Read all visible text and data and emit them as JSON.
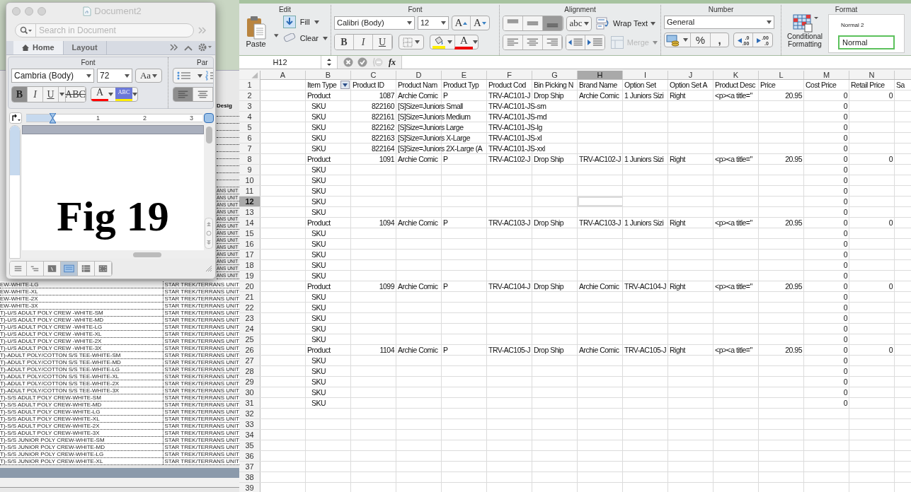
{
  "background_sheet": {
    "header": "Desig",
    "strip_rows": [
      "ANS UNIT",
      "ANS UNIT",
      "ANS UNIT",
      "ANS UNIT",
      "ANS UNIT",
      "ANS UNIT",
      "ANS UNIT",
      "ANS UNIT",
      "ANS UNIT",
      "ANS UNIT",
      "ANS UNIT",
      "ANS UNIT",
      "ANS UNIT"
    ],
    "rows": [
      {
        "description": "EW-WHITE-LG",
        "design": "STAR TREK/TERRANS UNIT"
      },
      {
        "description": "EW-WHITE-XL",
        "design": "STAR TREK/TERRANS UNIT"
      },
      {
        "description": "EW-WHITE-2X",
        "design": "STAR TREK/TERRANS UNIT"
      },
      {
        "description": "EW-WHITE-3X",
        "design": "STAR TREK/TERRANS UNIT"
      },
      {
        "description": "T)-U/S ADULT POLY CREW -WHITE-SM",
        "design": "STAR TREK/TERRANS UNIT"
      },
      {
        "description": "T)-U/S ADULT POLY CREW -WHITE-MD",
        "design": "STAR TREK/TERRANS UNIT"
      },
      {
        "description": "T)-U/S ADULT POLY CREW -WHITE-LG",
        "design": "STAR TREK/TERRANS UNIT"
      },
      {
        "description": "T)-U/S ADULT POLY CREW -WHITE-XL",
        "design": "STAR TREK/TERRANS UNIT"
      },
      {
        "description": "T)-U/S ADULT POLY CREW -WHITE-2X",
        "design": "STAR TREK/TERRANS UNIT"
      },
      {
        "description": "T)-U/S ADULT POLY CREW -WHITE-3X",
        "design": "STAR TREK/TERRANS UNIT"
      },
      {
        "description": "T)-ADULT POLY/COTTON S/S TEE-WHITE-SM",
        "design": "STAR TREK/TERRANS UNIT"
      },
      {
        "description": "T)-ADULT POLY/COTTON S/S TEE-WHITE-MD",
        "design": "STAR TREK/TERRANS UNIT"
      },
      {
        "description": "T)-ADULT POLY/COTTON S/S TEE-WHITE-LG",
        "design": "STAR TREK/TERRANS UNIT"
      },
      {
        "description": "T)-ADULT POLY/COTTON S/S TEE-WHITE-XL",
        "design": "STAR TREK/TERRANS UNIT"
      },
      {
        "description": "T)-ADULT POLY/COTTON S/S TEE-WHITE-2X",
        "design": "STAR TREK/TERRANS UNIT"
      },
      {
        "description": "T)-ADULT POLY/COTTON S/S TEE-WHITE-3X",
        "design": "STAR TREK/TERRANS UNIT"
      },
      {
        "description": "T)-S/S ADULT POLY CREW-WHITE-SM",
        "design": "STAR TREK/TERRANS UNIT"
      },
      {
        "description": "T)-S/S ADULT POLY CREW-WHITE-MD",
        "design": "STAR TREK/TERRANS UNIT"
      },
      {
        "description": "T)-S/S ADULT POLY CREW-WHITE-LG",
        "design": "STAR TREK/TERRANS UNIT"
      },
      {
        "description": "T)-S/S ADULT POLY CREW-WHITE-XL",
        "design": "STAR TREK/TERRANS UNIT"
      },
      {
        "description": "T)-S/S ADULT POLY CREW-WHITE-2X",
        "design": "STAR TREK/TERRANS UNIT"
      },
      {
        "description": "T)-S/S ADULT POLY CREW-WHITE-3X",
        "design": "STAR TREK/TERRANS UNIT"
      },
      {
        "description": "T)-S/S JUNIOR POLY CREW-WHITE-SM",
        "design": "STAR TREK/TERRANS UNIT"
      },
      {
        "description": "T)-S/S JUNIOR POLY CREW-WHITE-MD",
        "design": "STAR TREK/TERRANS UNIT"
      },
      {
        "description": "T)-S/S JUNIOR POLY CREW-WHITE-LG",
        "design": "STAR TREK/TERRANS UNIT"
      },
      {
        "description": "T)-S/S JUNIOR POLY CREW-WHITE-XL",
        "design": "STAR TREK/TERRANS UNIT"
      }
    ]
  },
  "word_window": {
    "title": "Document2",
    "search": {
      "placeholder": "Search in Document"
    },
    "tabs": [
      {
        "label": "Home",
        "selected": true
      },
      {
        "label": "Layout",
        "selected": false
      }
    ],
    "ribbon": {
      "groups": [
        "Font",
        "Par"
      ],
      "font": "Cambria (Body)",
      "size": "72",
      "case_button": "Aa",
      "format_buttons": [
        {
          "label": "B",
          "kind": "bold",
          "selected": true
        },
        {
          "label": "I",
          "kind": "italic",
          "selected": false
        },
        {
          "label": "U",
          "kind": "underline",
          "selected": false
        },
        {
          "label": "ABC",
          "kind": "strike",
          "selected": false
        }
      ],
      "font_color": "A",
      "highlight": "ABC",
      "align_buttons": [
        {
          "selected": true
        },
        {
          "selected": false
        }
      ]
    },
    "ruler_marks": [
      "1",
      "2",
      "3"
    ],
    "document_text": "Fig 19",
    "view_buttons": [
      {
        "selected": false
      },
      {
        "selected": false
      },
      {
        "selected": false
      },
      {
        "selected": true
      },
      {
        "selected": false
      },
      {
        "selected": false
      }
    ]
  },
  "excel": {
    "ribbon": {
      "edit": {
        "title": "Edit",
        "paste": "Paste",
        "fill": "Fill",
        "clear": "Clear"
      },
      "font": {
        "title": "Font",
        "font": "Calibri (Body)",
        "size": "12",
        "grow": "A",
        "shrink": "A",
        "format_buttons": [
          {
            "label": "B",
            "kind": "bold",
            "selected": false
          },
          {
            "label": "I",
            "kind": "italic",
            "selected": false
          },
          {
            "label": "U",
            "kind": "underline",
            "selected": false
          }
        ],
        "font_color": "A"
      },
      "alignment": {
        "title": "Alignment",
        "vertical_buttons": [
          {
            "selected": false
          },
          {
            "selected": false
          },
          {
            "selected": true
          }
        ],
        "orientation": "abc",
        "wrap_text": "Wrap Text",
        "merge": {
          "label": "Merge",
          "disabled": true
        }
      },
      "number": {
        "title": "Number",
        "format": "General",
        "percent": "%",
        "comma": ",",
        "increase_decimal": [
          ".0",
          ".00"
        ],
        "decrease_decimal": [
          ".00",
          ".0"
        ]
      },
      "format": {
        "title": "Format",
        "conditional_formatting": "Conditional Formatting",
        "styles": [
          {
            "label": "Normal 2",
            "selected": false
          },
          {
            "label": "Normal",
            "selected": true
          }
        ]
      }
    },
    "formula_bar": {
      "name_box": "H12",
      "fx": "fx"
    },
    "columns": [
      {
        "letter": "A",
        "selected": false
      },
      {
        "letter": "B",
        "selected": false
      },
      {
        "letter": "C",
        "selected": false
      },
      {
        "letter": "D",
        "selected": false
      },
      {
        "letter": "E",
        "selected": false
      },
      {
        "letter": "F",
        "selected": false
      },
      {
        "letter": "G",
        "selected": false
      },
      {
        "letter": "H",
        "selected": true
      },
      {
        "letter": "I",
        "selected": false
      },
      {
        "letter": "J",
        "selected": false
      },
      {
        "letter": "K",
        "selected": false
      },
      {
        "letter": "L",
        "selected": false
      },
      {
        "letter": "M",
        "selected": false
      },
      {
        "letter": "N",
        "selected": false
      }
    ],
    "rows": [
      {
        "number": "1",
        "selected": false,
        "cells": [
          {
            "kind": "empty"
          },
          {
            "text": "Item Type",
            "kind": "text",
            "filter": true
          },
          {
            "text": "Product ID",
            "kind": "text"
          },
          {
            "text": "Product Nam",
            "kind": "text"
          },
          {
            "text": "Product Typ",
            "kind": "text"
          },
          {
            "text": "Product Cod",
            "kind": "text"
          },
          {
            "text": "Bin Picking N",
            "kind": "text"
          },
          {
            "text": "Brand Name",
            "kind": "text"
          },
          {
            "text": "Option Set",
            "kind": "text"
          },
          {
            "text": "Option Set A",
            "kind": "text"
          },
          {
            "text": "Product Desc",
            "kind": "text"
          },
          {
            "text": "Price",
            "kind": "text"
          },
          {
            "text": "Cost Price",
            "kind": "text"
          },
          {
            "text": "Retail Price",
            "kind": "text"
          },
          {
            "text": "Sa",
            "kind": "text"
          }
        ]
      },
      {
        "number": "2",
        "selected": false,
        "cells": [
          {
            "kind": "empty"
          },
          {
            "text": "Product",
            "kind": "text"
          },
          {
            "text": "1087",
            "kind": "number"
          },
          {
            "text": "Archie Comic",
            "kind": "text"
          },
          {
            "text": "P",
            "kind": "text"
          },
          {
            "text": "TRV-AC101-J",
            "kind": "text"
          },
          {
            "text": "Drop Ship",
            "kind": "text"
          },
          {
            "text": "Archie Comic",
            "kind": "text"
          },
          {
            "text": "1 Juniors Sizi",
            "kind": "text"
          },
          {
            "text": "Right",
            "kind": "text"
          },
          {
            "text": "<p><a title=\"",
            "kind": "text"
          },
          {
            "text": "20.95",
            "kind": "number"
          },
          {
            "text": "0",
            "kind": "number"
          },
          {
            "text": "0",
            "kind": "number"
          }
        ]
      },
      {
        "number": "3",
        "selected": false,
        "cells": [
          {
            "kind": "empty"
          },
          {
            "text": "SKU",
            "kind": "indented"
          },
          {
            "text": "822160",
            "kind": "number"
          },
          {
            "text": "[S]Size=Juniors Small",
            "kind": "text"
          },
          {
            "kind": "empty"
          },
          {
            "text": "TRV-AC101-JS-sm",
            "kind": "text"
          },
          {
            "kind": "empty"
          },
          {
            "kind": "empty"
          },
          {
            "kind": "empty"
          },
          {
            "kind": "empty"
          },
          {
            "kind": "empty"
          },
          {
            "kind": "empty"
          },
          {
            "text": "0",
            "kind": "number"
          }
        ]
      },
      {
        "number": "4",
        "selected": false,
        "cells": [
          {
            "kind": "empty"
          },
          {
            "text": "SKU",
            "kind": "indented"
          },
          {
            "text": "822161",
            "kind": "number"
          },
          {
            "text": "[S]Size=Juniors Medium",
            "kind": "text"
          },
          {
            "kind": "empty"
          },
          {
            "text": "TRV-AC101-JS-md",
            "kind": "text"
          },
          {
            "kind": "empty"
          },
          {
            "kind": "empty"
          },
          {
            "kind": "empty"
          },
          {
            "kind": "empty"
          },
          {
            "kind": "empty"
          },
          {
            "kind": "empty"
          },
          {
            "text": "0",
            "kind": "number"
          }
        ]
      },
      {
        "number": "5",
        "selected": false,
        "cells": [
          {
            "kind": "empty"
          },
          {
            "text": "SKU",
            "kind": "indented"
          },
          {
            "text": "822162",
            "kind": "number"
          },
          {
            "text": "[S]Size=Juniors Large",
            "kind": "text"
          },
          {
            "kind": "empty"
          },
          {
            "text": "TRV-AC101-JS-lg",
            "kind": "text"
          },
          {
            "kind": "empty"
          },
          {
            "kind": "empty"
          },
          {
            "kind": "empty"
          },
          {
            "kind": "empty"
          },
          {
            "kind": "empty"
          },
          {
            "kind": "empty"
          },
          {
            "text": "0",
            "kind": "number"
          }
        ]
      },
      {
        "number": "6",
        "selected": false,
        "cells": [
          {
            "kind": "empty"
          },
          {
            "text": "SKU",
            "kind": "indented"
          },
          {
            "text": "822163",
            "kind": "number"
          },
          {
            "text": "[S]Size=Juniors X-Large",
            "kind": "text"
          },
          {
            "kind": "empty"
          },
          {
            "text": "TRV-AC101-JS-xl",
            "kind": "text"
          },
          {
            "kind": "empty"
          },
          {
            "kind": "empty"
          },
          {
            "kind": "empty"
          },
          {
            "kind": "empty"
          },
          {
            "kind": "empty"
          },
          {
            "kind": "empty"
          },
          {
            "text": "0",
            "kind": "number"
          }
        ]
      },
      {
        "number": "7",
        "selected": false,
        "cells": [
          {
            "kind": "empty"
          },
          {
            "text": "SKU",
            "kind": "indented"
          },
          {
            "text": "822164",
            "kind": "number"
          },
          {
            "text": "[S]Size=Juniors 2X-Large (A",
            "kind": "text"
          },
          {
            "kind": "empty"
          },
          {
            "text": "TRV-AC101-JS-xxl",
            "kind": "text"
          },
          {
            "kind": "empty"
          },
          {
            "kind": "empty"
          },
          {
            "kind": "empty"
          },
          {
            "kind": "empty"
          },
          {
            "kind": "empty"
          },
          {
            "kind": "empty"
          },
          {
            "text": "0",
            "kind": "number"
          }
        ]
      },
      {
        "number": "8",
        "selected": false,
        "cells": [
          {
            "kind": "empty"
          },
          {
            "text": "Product",
            "kind": "text"
          },
          {
            "text": "1091",
            "kind": "number"
          },
          {
            "text": "Archie Comic",
            "kind": "text"
          },
          {
            "text": "P",
            "kind": "text"
          },
          {
            "text": "TRV-AC102-J",
            "kind": "text"
          },
          {
            "text": "Drop Ship",
            "kind": "text"
          },
          {
            "text": "TRV-AC102-J",
            "kind": "text"
          },
          {
            "text": "1 Juniors Sizi",
            "kind": "text"
          },
          {
            "text": "Right",
            "kind": "text"
          },
          {
            "text": "<p><a title=\"",
            "kind": "text"
          },
          {
            "text": "20.95",
            "kind": "number"
          },
          {
            "text": "0",
            "kind": "number"
          },
          {
            "text": "0",
            "kind": "number"
          }
        ]
      },
      {
        "number": "9",
        "selected": false,
        "cells": [
          {
            "kind": "empty"
          },
          {
            "text": "SKU",
            "kind": "indented"
          },
          {
            "kind": "empty"
          },
          {
            "kind": "empty"
          },
          {
            "kind": "empty"
          },
          {
            "kind": "empty"
          },
          {
            "kind": "empty"
          },
          {
            "kind": "empty"
          },
          {
            "kind": "empty"
          },
          {
            "kind": "empty"
          },
          {
            "kind": "empty"
          },
          {
            "kind": "empty"
          },
          {
            "text": "0",
            "kind": "number"
          }
        ]
      },
      {
        "number": "10",
        "selected": false,
        "cells": [
          {
            "kind": "empty"
          },
          {
            "text": "SKU",
            "kind": "indented"
          },
          {
            "kind": "empty"
          },
          {
            "kind": "empty"
          },
          {
            "kind": "empty"
          },
          {
            "kind": "empty"
          },
          {
            "kind": "empty"
          },
          {
            "kind": "empty"
          },
          {
            "kind": "empty"
          },
          {
            "kind": "empty"
          },
          {
            "kind": "empty"
          },
          {
            "kind": "empty"
          },
          {
            "text": "0",
            "kind": "number"
          }
        ]
      },
      {
        "number": "11",
        "selected": false,
        "cells": [
          {
            "kind": "empty"
          },
          {
            "text": "SKU",
            "kind": "indented"
          },
          {
            "kind": "empty"
          },
          {
            "kind": "empty"
          },
          {
            "kind": "empty"
          },
          {
            "kind": "empty"
          },
          {
            "kind": "empty"
          },
          {
            "kind": "empty"
          },
          {
            "kind": "empty"
          },
          {
            "kind": "empty"
          },
          {
            "kind": "empty"
          },
          {
            "kind": "empty"
          },
          {
            "text": "0",
            "kind": "number"
          }
        ]
      },
      {
        "number": "12",
        "selected": true,
        "cells": [
          {
            "kind": "empty"
          },
          {
            "text": "SKU",
            "kind": "indented"
          },
          {
            "kind": "empty"
          },
          {
            "kind": "empty"
          },
          {
            "kind": "empty"
          },
          {
            "kind": "empty"
          },
          {
            "kind": "empty"
          },
          {
            "kind": "empty",
            "active": true
          },
          {
            "kind": "empty"
          },
          {
            "kind": "empty"
          },
          {
            "kind": "empty"
          },
          {
            "kind": "empty"
          },
          {
            "text": "0",
            "kind": "number"
          }
        ]
      },
      {
        "number": "13",
        "selected": false,
        "cells": [
          {
            "kind": "empty"
          },
          {
            "text": "SKU",
            "kind": "indented"
          },
          {
            "kind": "empty"
          },
          {
            "kind": "empty"
          },
          {
            "kind": "empty"
          },
          {
            "kind": "empty"
          },
          {
            "kind": "empty"
          },
          {
            "kind": "empty"
          },
          {
            "kind": "empty"
          },
          {
            "kind": "empty"
          },
          {
            "kind": "empty"
          },
          {
            "kind": "empty"
          },
          {
            "text": "0",
            "kind": "number"
          }
        ]
      },
      {
        "number": "14",
        "selected": false,
        "cells": [
          {
            "kind": "empty"
          },
          {
            "text": "Product",
            "kind": "text"
          },
          {
            "text": "1094",
            "kind": "number"
          },
          {
            "text": "Archie Comic",
            "kind": "text"
          },
          {
            "text": "P",
            "kind": "text"
          },
          {
            "text": "TRV-AC103-J",
            "kind": "text"
          },
          {
            "text": "Drop Ship",
            "kind": "text"
          },
          {
            "text": "TRV-AC103-J",
            "kind": "text"
          },
          {
            "text": "1 Juniors Sizi",
            "kind": "text"
          },
          {
            "text": "Right",
            "kind": "text"
          },
          {
            "text": "<p><a title=\"",
            "kind": "text"
          },
          {
            "text": "20.95",
            "kind": "number"
          },
          {
            "text": "0",
            "kind": "number"
          },
          {
            "text": "0",
            "kind": "number"
          }
        ]
      },
      {
        "number": "15",
        "selected": false,
        "cells": [
          {
            "kind": "empty"
          },
          {
            "text": "SKU",
            "kind": "indented"
          },
          {
            "kind": "empty"
          },
          {
            "kind": "empty"
          },
          {
            "kind": "empty"
          },
          {
            "kind": "empty"
          },
          {
            "kind": "empty"
          },
          {
            "kind": "empty"
          },
          {
            "kind": "empty"
          },
          {
            "kind": "empty"
          },
          {
            "kind": "empty"
          },
          {
            "kind": "empty"
          },
          {
            "text": "0",
            "kind": "number"
          }
        ]
      },
      {
        "number": "16",
        "selected": false,
        "cells": [
          {
            "kind": "empty"
          },
          {
            "text": "SKU",
            "kind": "indented"
          },
          {
            "kind": "empty"
          },
          {
            "kind": "empty"
          },
          {
            "kind": "empty"
          },
          {
            "kind": "empty"
          },
          {
            "kind": "empty"
          },
          {
            "kind": "empty"
          },
          {
            "kind": "empty"
          },
          {
            "kind": "empty"
          },
          {
            "kind": "empty"
          },
          {
            "kind": "empty"
          },
          {
            "text": "0",
            "kind": "number"
          }
        ]
      },
      {
        "number": "17",
        "selected": false,
        "cells": [
          {
            "kind": "empty"
          },
          {
            "text": "SKU",
            "kind": "indented"
          },
          {
            "kind": "empty"
          },
          {
            "kind": "empty"
          },
          {
            "kind": "empty"
          },
          {
            "kind": "empty"
          },
          {
            "kind": "empty"
          },
          {
            "kind": "empty"
          },
          {
            "kind": "empty"
          },
          {
            "kind": "empty"
          },
          {
            "kind": "empty"
          },
          {
            "kind": "empty"
          },
          {
            "text": "0",
            "kind": "number"
          }
        ]
      },
      {
        "number": "18",
        "selected": false,
        "cells": [
          {
            "kind": "empty"
          },
          {
            "text": "SKU",
            "kind": "indented"
          },
          {
            "kind": "empty"
          },
          {
            "kind": "empty"
          },
          {
            "kind": "empty"
          },
          {
            "kind": "empty"
          },
          {
            "kind": "empty"
          },
          {
            "kind": "empty"
          },
          {
            "kind": "empty"
          },
          {
            "kind": "empty"
          },
          {
            "kind": "empty"
          },
          {
            "kind": "empty"
          },
          {
            "text": "0",
            "kind": "number"
          }
        ]
      },
      {
        "number": "19",
        "selected": false,
        "cells": [
          {
            "kind": "empty"
          },
          {
            "text": "SKU",
            "kind": "indented"
          },
          {
            "kind": "empty"
          },
          {
            "kind": "empty"
          },
          {
            "kind": "empty"
          },
          {
            "kind": "empty"
          },
          {
            "kind": "empty"
          },
          {
            "kind": "empty"
          },
          {
            "kind": "empty"
          },
          {
            "kind": "empty"
          },
          {
            "kind": "empty"
          },
          {
            "kind": "empty"
          },
          {
            "text": "0",
            "kind": "number"
          }
        ]
      },
      {
        "number": "20",
        "selected": false,
        "cells": [
          {
            "kind": "empty"
          },
          {
            "text": "Product",
            "kind": "text"
          },
          {
            "text": "1099",
            "kind": "number"
          },
          {
            "text": "Archie Comic",
            "kind": "text"
          },
          {
            "text": "P",
            "kind": "text"
          },
          {
            "text": "TRV-AC104-J",
            "kind": "text"
          },
          {
            "text": "Drop Ship",
            "kind": "text"
          },
          {
            "text": "Archie Comic",
            "kind": "text"
          },
          {
            "text": "TRV-AC104-J",
            "kind": "text"
          },
          {
            "text": "Right",
            "kind": "text"
          },
          {
            "text": "<p><a title=\"",
            "kind": "text"
          },
          {
            "text": "20.95",
            "kind": "number"
          },
          {
            "text": "0",
            "kind": "number"
          },
          {
            "text": "0",
            "kind": "number"
          }
        ]
      },
      {
        "number": "21",
        "selected": false,
        "cells": [
          {
            "kind": "empty"
          },
          {
            "text": "SKU",
            "kind": "indented"
          },
          {
            "kind": "empty"
          },
          {
            "kind": "empty"
          },
          {
            "kind": "empty"
          },
          {
            "kind": "empty"
          },
          {
            "kind": "empty"
          },
          {
            "kind": "empty"
          },
          {
            "kind": "empty"
          },
          {
            "kind": "empty"
          },
          {
            "kind": "empty"
          },
          {
            "kind": "empty"
          },
          {
            "text": "0",
            "kind": "number"
          }
        ]
      },
      {
        "number": "22",
        "selected": false,
        "cells": [
          {
            "kind": "empty"
          },
          {
            "text": "SKU",
            "kind": "indented"
          },
          {
            "kind": "empty"
          },
          {
            "kind": "empty"
          },
          {
            "kind": "empty"
          },
          {
            "kind": "empty"
          },
          {
            "kind": "empty"
          },
          {
            "kind": "empty"
          },
          {
            "kind": "empty"
          },
          {
            "kind": "empty"
          },
          {
            "kind": "empty"
          },
          {
            "kind": "empty"
          },
          {
            "text": "0",
            "kind": "number"
          }
        ]
      },
      {
        "number": "23",
        "selected": false,
        "cells": [
          {
            "kind": "empty"
          },
          {
            "text": "SKU",
            "kind": "indented"
          },
          {
            "kind": "empty"
          },
          {
            "kind": "empty"
          },
          {
            "kind": "empty"
          },
          {
            "kind": "empty"
          },
          {
            "kind": "empty"
          },
          {
            "kind": "empty"
          },
          {
            "kind": "empty"
          },
          {
            "kind": "empty"
          },
          {
            "kind": "empty"
          },
          {
            "kind": "empty"
          },
          {
            "text": "0",
            "kind": "number"
          }
        ]
      },
      {
        "number": "24",
        "selected": false,
        "cells": [
          {
            "kind": "empty"
          },
          {
            "text": "SKU",
            "kind": "indented"
          },
          {
            "kind": "empty"
          },
          {
            "kind": "empty"
          },
          {
            "kind": "empty"
          },
          {
            "kind": "empty"
          },
          {
            "kind": "empty"
          },
          {
            "kind": "empty"
          },
          {
            "kind": "empty"
          },
          {
            "kind": "empty"
          },
          {
            "kind": "empty"
          },
          {
            "kind": "empty"
          },
          {
            "text": "0",
            "kind": "number"
          }
        ]
      },
      {
        "number": "25",
        "selected": false,
        "cells": [
          {
            "kind": "empty"
          },
          {
            "text": "SKU",
            "kind": "indented"
          },
          {
            "kind": "empty"
          },
          {
            "kind": "empty"
          },
          {
            "kind": "empty"
          },
          {
            "kind": "empty"
          },
          {
            "kind": "empty"
          },
          {
            "kind": "empty"
          },
          {
            "kind": "empty"
          },
          {
            "kind": "empty"
          },
          {
            "kind": "empty"
          },
          {
            "kind": "empty"
          },
          {
            "text": "0",
            "kind": "number"
          }
        ]
      },
      {
        "number": "26",
        "selected": false,
        "cells": [
          {
            "kind": "empty"
          },
          {
            "text": "Product",
            "kind": "text"
          },
          {
            "text": "1104",
            "kind": "number"
          },
          {
            "text": "Archie Comic",
            "kind": "text"
          },
          {
            "text": "P",
            "kind": "text"
          },
          {
            "text": "TRV-AC105-J",
            "kind": "text"
          },
          {
            "text": "Drop Ship",
            "kind": "text"
          },
          {
            "text": "Archie Comic",
            "kind": "text"
          },
          {
            "text": "TRV-AC105-J",
            "kind": "text"
          },
          {
            "text": "Right",
            "kind": "text"
          },
          {
            "text": "<p><a title=\"",
            "kind": "text"
          },
          {
            "text": "20.95",
            "kind": "number"
          },
          {
            "text": "0",
            "kind": "number"
          },
          {
            "text": "0",
            "kind": "number"
          }
        ]
      },
      {
        "number": "27",
        "selected": false,
        "cells": [
          {
            "kind": "empty"
          },
          {
            "text": "SKU",
            "kind": "indented"
          },
          {
            "kind": "empty"
          },
          {
            "kind": "empty"
          },
          {
            "kind": "empty"
          },
          {
            "kind": "empty"
          },
          {
            "kind": "empty"
          },
          {
            "kind": "empty"
          },
          {
            "kind": "empty"
          },
          {
            "kind": "empty"
          },
          {
            "kind": "empty"
          },
          {
            "kind": "empty"
          },
          {
            "text": "0",
            "kind": "number"
          }
        ]
      },
      {
        "number": "28",
        "selected": false,
        "cells": [
          {
            "kind": "empty"
          },
          {
            "text": "SKU",
            "kind": "indented"
          },
          {
            "kind": "empty"
          },
          {
            "kind": "empty"
          },
          {
            "kind": "empty"
          },
          {
            "kind": "empty"
          },
          {
            "kind": "empty"
          },
          {
            "kind": "empty"
          },
          {
            "kind": "empty"
          },
          {
            "kind": "empty"
          },
          {
            "kind": "empty"
          },
          {
            "kind": "empty"
          },
          {
            "text": "0",
            "kind": "number"
          }
        ]
      },
      {
        "number": "29",
        "selected": false,
        "cells": [
          {
            "kind": "empty"
          },
          {
            "text": "SKU",
            "kind": "indented"
          },
          {
            "kind": "empty"
          },
          {
            "kind": "empty"
          },
          {
            "kind": "empty"
          },
          {
            "kind": "empty"
          },
          {
            "kind": "empty"
          },
          {
            "kind": "empty"
          },
          {
            "kind": "empty"
          },
          {
            "kind": "empty"
          },
          {
            "kind": "empty"
          },
          {
            "kind": "empty"
          },
          {
            "text": "0",
            "kind": "number"
          }
        ]
      },
      {
        "number": "30",
        "selected": false,
        "cells": [
          {
            "kind": "empty"
          },
          {
            "text": "SKU",
            "kind": "indented"
          },
          {
            "kind": "empty"
          },
          {
            "kind": "empty"
          },
          {
            "kind": "empty"
          },
          {
            "kind": "empty"
          },
          {
            "kind": "empty"
          },
          {
            "kind": "empty"
          },
          {
            "kind": "empty"
          },
          {
            "kind": "empty"
          },
          {
            "kind": "empty"
          },
          {
            "kind": "empty"
          },
          {
            "text": "0",
            "kind": "number"
          }
        ]
      },
      {
        "number": "31",
        "selected": false,
        "cells": [
          {
            "kind": "empty"
          },
          {
            "text": "SKU",
            "kind": "indented"
          },
          {
            "kind": "empty"
          },
          {
            "kind": "empty"
          },
          {
            "kind": "empty"
          },
          {
            "kind": "empty"
          },
          {
            "kind": "empty"
          },
          {
            "kind": "empty"
          },
          {
            "kind": "empty"
          },
          {
            "kind": "empty"
          },
          {
            "kind": "empty"
          },
          {
            "kind": "empty"
          },
          {
            "text": "0",
            "kind": "number"
          }
        ]
      },
      {
        "number": "32",
        "selected": false
      },
      {
        "number": "33",
        "selected": false
      },
      {
        "number": "34",
        "selected": false
      },
      {
        "number": "35",
        "selected": false
      },
      {
        "number": "36",
        "selected": false
      },
      {
        "number": "37",
        "selected": false
      },
      {
        "number": "38",
        "selected": false
      },
      {
        "number": "39",
        "selected": false
      }
    ]
  }
}
